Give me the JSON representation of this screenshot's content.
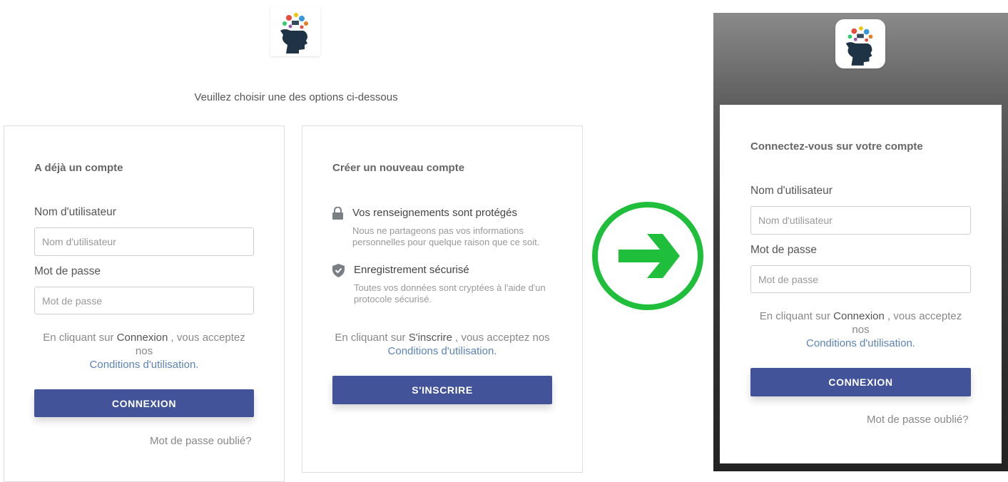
{
  "intro": "Veuillez choisir une des options ci-dessous",
  "login_card": {
    "title": "A déjà un compte",
    "username_label": "Nom d'utilisateur",
    "username_placeholder": "Nom d'utilisateur",
    "password_label": "Mot de passe",
    "password_placeholder": "Mot de passe",
    "terms_prefix": "En cliquant sur",
    "terms_action": "Connexion",
    "terms_suffix": ", vous acceptez nos",
    "terms_link": "Conditions d'utilisation.",
    "button": "CONNEXION",
    "forgot": "Mot de passe oublié?"
  },
  "register_card": {
    "title": "Créer un nouveau compte",
    "features": [
      {
        "icon": "lock-icon",
        "title": "Vos renseignements sont protégés",
        "desc": "Nous ne partageons pas vos informations personnelles pour quelque raison que ce soit."
      },
      {
        "icon": "shield-check-icon",
        "title": "Enregistrement sécurisé",
        "desc": "Toutes vos données sont cryptées à l'aide d'un protocole sécurisé."
      }
    ],
    "terms_prefix": "En cliquant sur",
    "terms_action": "S'inscrire",
    "terms_suffix": ", vous acceptez nos",
    "terms_link": "Conditions d'utilisation.",
    "button": "S'INSCRIRE"
  },
  "arrow": {
    "icon": "arrow-right-circle-icon",
    "color": "#1fbf3c"
  },
  "mobile": {
    "title": "Connectez-vous sur votre compte",
    "username_label": "Nom d'utilisateur",
    "username_placeholder": "Nom d'utilisateur",
    "password_label": "Mot de passe",
    "password_placeholder": "Mot de passe",
    "terms_prefix": "En cliquant sur",
    "terms_action": "Connexion",
    "terms_suffix": ", vous acceptez nos",
    "terms_link": "Conditions d'utilisation.",
    "button": "CONNEXION",
    "forgot": "Mot de passe oublié?"
  },
  "colors": {
    "accent": "#42539a",
    "link": "#5b83b8",
    "arrow": "#1fbf3c"
  }
}
